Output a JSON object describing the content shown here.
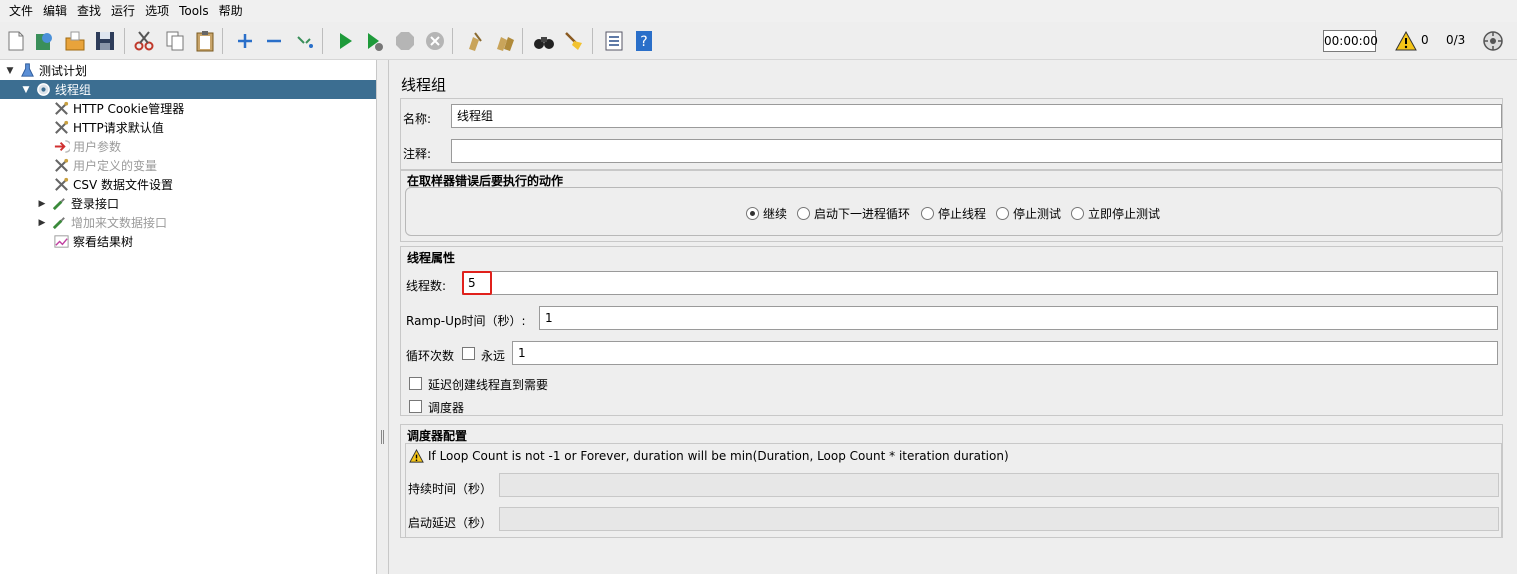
{
  "menu": [
    "文件",
    "编辑",
    "查找",
    "运行",
    "选项",
    "Tools",
    "帮助"
  ],
  "toolbar": {
    "timer": "00:00:00",
    "warning_count": "0",
    "thread_ratio": "0/3"
  },
  "tree": {
    "items": [
      {
        "label": "测试计划"
      },
      {
        "label": "线程组"
      },
      {
        "label": "HTTP Cookie管理器"
      },
      {
        "label": "HTTP请求默认值"
      },
      {
        "label": "用户参数"
      },
      {
        "label": "用户定义的变量"
      },
      {
        "label": "CSV 数据文件设置"
      },
      {
        "label": "登录接口"
      },
      {
        "label": "增加来文数据接口"
      },
      {
        "label": "察看结果树"
      }
    ]
  },
  "panel": {
    "title": "线程组",
    "name_label": "名称:",
    "name_value": "线程组",
    "comment_label": "注释:",
    "comment_value": "",
    "error_action": {
      "heading": "在取样器错误后要执行的动作",
      "options": [
        "继续",
        "启动下一进程循环",
        "停止线程",
        "停止测试",
        "立即停止测试"
      ],
      "selected": "继续"
    },
    "thread_props": {
      "heading": "线程属性",
      "threads_label": "线程数:",
      "threads_value": "5",
      "rampup_label": "Ramp-Up时间（秒）:",
      "rampup_value": "1",
      "loop_label": "循环次数",
      "forever_label": "永远",
      "loop_value": "1",
      "delay_label": "延迟创建线程直到需要",
      "scheduler_label": "调度器"
    },
    "scheduler": {
      "heading": "调度器配置",
      "warning": "If Loop Count is not -1 or Forever, duration will be min(Duration, Loop Count * iteration duration)",
      "duration_label": "持续时间（秒）",
      "startup_delay_label": "启动延迟（秒）"
    }
  }
}
